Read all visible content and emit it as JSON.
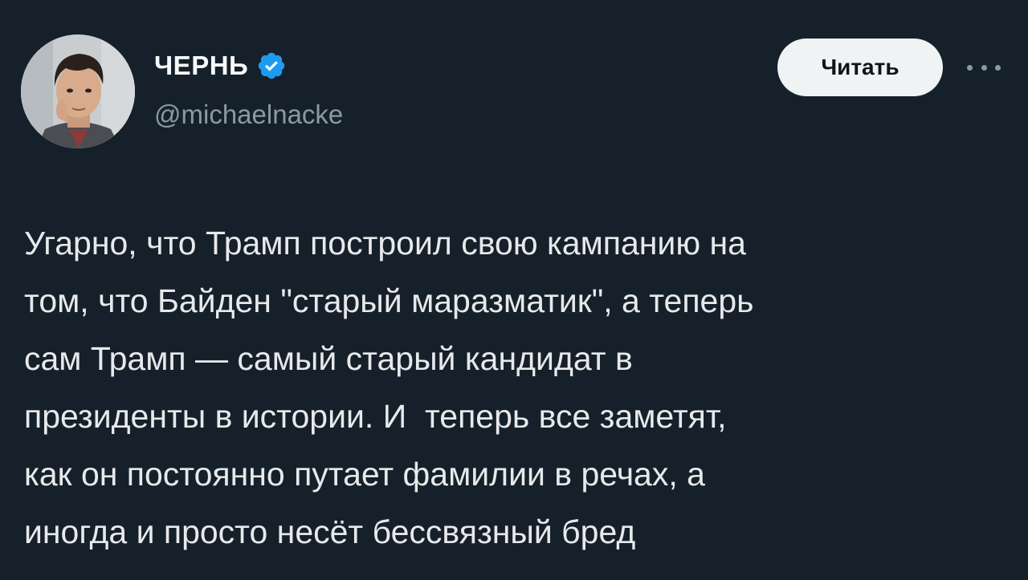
{
  "author": {
    "display_name": "ЧЕРНЬ",
    "handle": "@michaelnacke",
    "verified": true,
    "avatar_icon": "user-avatar-photo"
  },
  "actions": {
    "follow_label": "Читать",
    "more_icon": "more-horizontal-icon"
  },
  "tweet": {
    "text": "Угарно, что Трамп построил свою кампанию на\nтом, что Байден \"старый маразматик\", а теперь\nсам Трамп — самый старый кандидат в\nпрезиденты в истории. И  теперь все заметят,\nкак он постоянно путает фамилии в речах, а\nиногда и просто несёт бессвязный бред"
  },
  "colors": {
    "background": "#15202b",
    "text": "#e7e9ea",
    "secondary_text": "#8b98a5",
    "verified_badge": "#1d9bf0",
    "button_background": "#eff3f4",
    "button_text": "#0f1419"
  }
}
